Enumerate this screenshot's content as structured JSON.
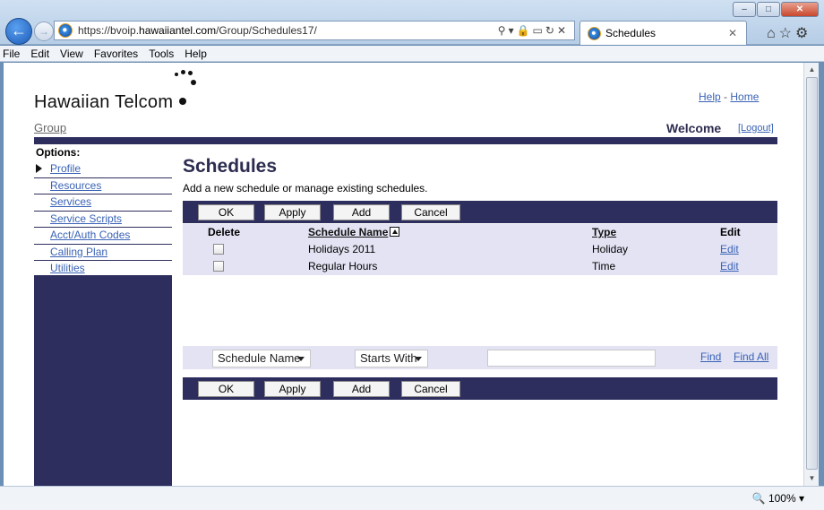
{
  "browser": {
    "url_prefix": "https://bvoip.",
    "url_domain": "hawaiiantel.com",
    "url_path": "/Group/Schedules17/",
    "tab_title": "Schedules",
    "zoom": "100%",
    "menu": [
      "File",
      "Edit",
      "View",
      "Favorites",
      "Tools",
      "Help"
    ]
  },
  "header": {
    "logo_text": "Hawaiian Telcom",
    "group_link": "Group",
    "help": "Help",
    "separator": "-",
    "home": "Home",
    "welcome": "Welcome",
    "logout": "[Logout]"
  },
  "sidebar": {
    "title": "Options:",
    "items": [
      "Profile",
      "Resources",
      "Services",
      "Service Scripts",
      "Acct/Auth Codes",
      "Calling Plan",
      "Utilities"
    ]
  },
  "main": {
    "title": "Schedules",
    "subtitle": "Add a new schedule or manage existing schedules.",
    "buttons": {
      "ok": "OK",
      "apply": "Apply",
      "add": "Add",
      "cancel": "Cancel"
    },
    "columns": {
      "delete": "Delete",
      "name": "Schedule Name",
      "type": "Type",
      "edit": "Edit"
    },
    "rows": [
      {
        "name": "Holidays 2011",
        "type": "Holiday",
        "edit": "Edit"
      },
      {
        "name": "Regular Hours",
        "type": "Time",
        "edit": "Edit"
      }
    ],
    "filter": {
      "field": "Schedule Name",
      "mode": "Starts With",
      "value": "",
      "find": "Find",
      "find_all": "Find All"
    }
  },
  "colors": {
    "navy": "#2e2e5e",
    "row_bg": "#e3e3f4",
    "link": "#3a63b5"
  }
}
